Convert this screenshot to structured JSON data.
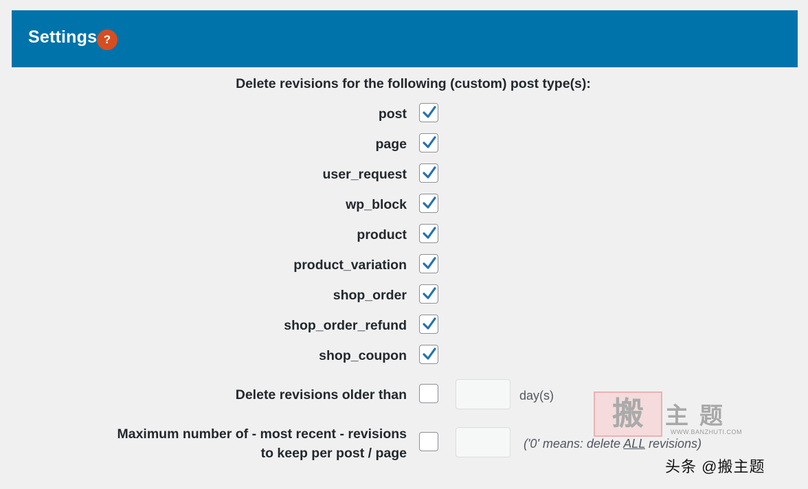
{
  "header": {
    "title": "Settings",
    "help_icon_glyph": "?"
  },
  "section": {
    "title": "Delete revisions for the following (custom) post type(s):"
  },
  "post_types": [
    {
      "label": "post",
      "checked": true
    },
    {
      "label": "page",
      "checked": true
    },
    {
      "label": "user_request",
      "checked": true
    },
    {
      "label": "wp_block",
      "checked": true
    },
    {
      "label": "product",
      "checked": true
    },
    {
      "label": "product_variation",
      "checked": true
    },
    {
      "label": "shop_order",
      "checked": true
    },
    {
      "label": "shop_order_refund",
      "checked": true
    },
    {
      "label": "shop_coupon",
      "checked": true
    }
  ],
  "older_than": {
    "label": "Delete revisions older than",
    "checked": false,
    "value": "",
    "unit": "day(s)"
  },
  "max_revisions": {
    "label_line1": "Maximum number of - most recent - revisions",
    "label_line2": "to keep per post / page",
    "checked": false,
    "value": "",
    "hint_prefix": "('0' means: delete ",
    "hint_emphasis": "ALL",
    "hint_suffix": " revisions)"
  },
  "watermark": {
    "stamp": "搬",
    "text": "主题",
    "url": "WWW.BANZHUTI.COM",
    "credit": "头条 @搬主题"
  },
  "colors": {
    "header_bg": "#0073aa",
    "help_icon_bg": "#d54e21",
    "checkmark": "#2271b1"
  }
}
